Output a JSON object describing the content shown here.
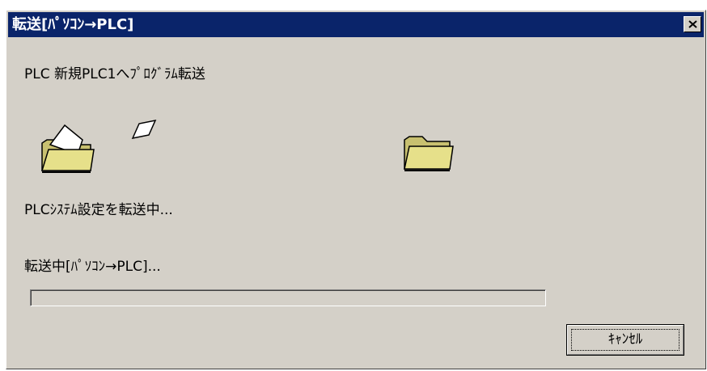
{
  "window": {
    "title": "転送[ﾊﾟｿｺﾝ→PLC]",
    "close_symbol": "×"
  },
  "header_text": "PLC 新規PLC1へﾌﾟﾛｸﾞﾗﾑ転送",
  "animation": {
    "source_icon": "open-folder-icon",
    "flying_icon": "flying-document-icon",
    "target_icon": "folder-icon"
  },
  "status_text": "PLCｼｽﾃﾑ設定を転送中...",
  "progress": {
    "label": "転送中[ﾊﾟｿｺﾝ→PLC]...",
    "fraction": 0
  },
  "buttons": {
    "cancel_label": "ｷｬﾝｾﾙ"
  },
  "colors": {
    "title_bar": "#0a246a",
    "dialog_face": "#d4d0c8",
    "folder_yellow": "#e6e08a"
  }
}
